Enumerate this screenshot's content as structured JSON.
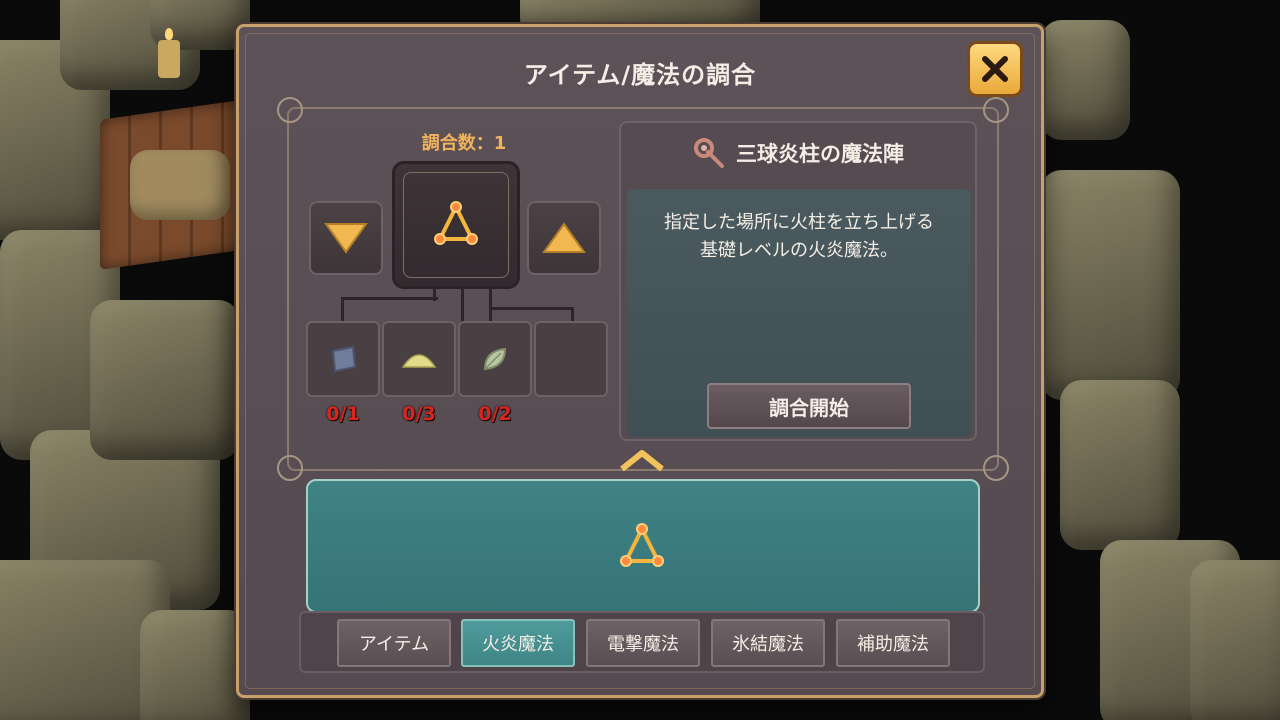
{
  "dialog": {
    "title": "アイテム/魔法の調合",
    "close_icon": "close-x-icon"
  },
  "craft": {
    "count_label": "調合数：1",
    "decrease_icon": "triangle-down-icon",
    "increase_icon": "triangle-up-icon",
    "selected_icon": "fire-triangle-magic-icon",
    "ingredients": [
      {
        "icon": "stone-cloth-icon",
        "count": "0/1"
      },
      {
        "icon": "powder-pile-icon",
        "count": "0/3"
      },
      {
        "icon": "leaf-icon",
        "count": "0/2"
      },
      {
        "icon": "",
        "count": ""
      }
    ]
  },
  "info": {
    "icon": "magic-staff-icon",
    "name": "三球炎柱の魔法陣",
    "description_line1": "指定した場所に火柱を立ち上げる",
    "description_line2": "基礎レベルの火炎魔法。",
    "start_button": "調合開始"
  },
  "list": {
    "expand_icon": "chevron-up-icon",
    "items": [
      {
        "icon": "fire-triangle-magic-icon"
      }
    ]
  },
  "tabs": [
    {
      "label": "アイテム",
      "active": false
    },
    {
      "label": "火炎魔法",
      "active": true
    },
    {
      "label": "電撃魔法",
      "active": false
    },
    {
      "label": "氷結魔法",
      "active": false
    },
    {
      "label": "補助魔法",
      "active": false
    }
  ],
  "colors": {
    "accent_gold": "#f0b25d",
    "missing_red": "#d8261f",
    "active_tab": "#4f9b9c",
    "panel_teal": "#3f8385"
  }
}
